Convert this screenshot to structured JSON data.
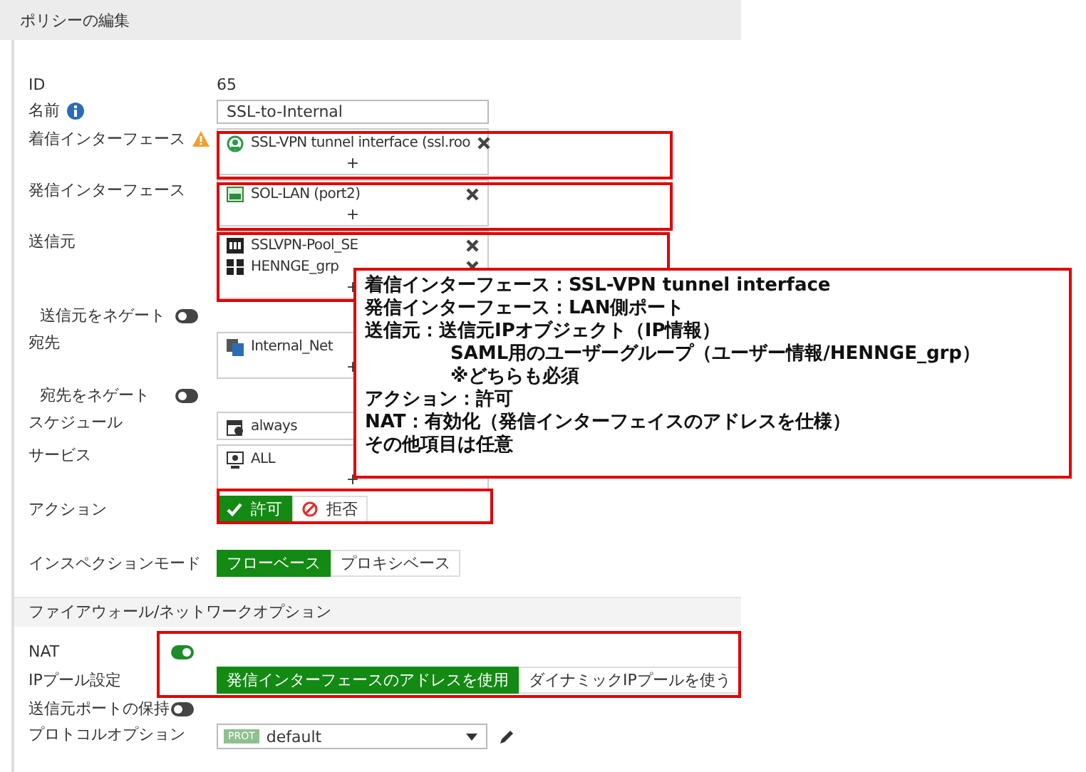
{
  "window": {
    "title": "ポリシーの編集"
  },
  "sections": [
    {
      "rows": [
        {
          "kind": "text",
          "label": "ID",
          "value": "65"
        },
        {
          "kind": "input",
          "label": "名前",
          "label_icon": {
            "kind": "info"
          },
          "value": "SSL-to-Internal"
        },
        {
          "kind": "multi",
          "label": "着信インターフェース",
          "label_icon": {
            "kind": "warning"
          },
          "entries": [
            {
              "kind": "tunnel",
              "text": "SSL-VPN tunnel interface (ssl.roo",
              "removable": true
            }
          ],
          "add": "+"
        },
        {
          "kind": "multi",
          "label": "発信インターフェース",
          "entries": [
            {
              "kind": "port",
              "text": "SOL-LAN (port2)",
              "removable": true
            }
          ],
          "add": "+"
        },
        {
          "kind": "multi",
          "label": "送信元",
          "entries": [
            {
              "kind": "range",
              "text": "SSLVPN-Pool_SE",
              "removable": true
            },
            {
              "kind": "group",
              "text": "HENNGE_grp",
              "removable": true
            }
          ],
          "add": "+",
          "negate": {
            "label": "送信元をネゲート",
            "on": false
          }
        },
        {
          "kind": "multi",
          "label": "宛先",
          "entries": [
            {
              "kind": "address",
              "text": "Internal_Net",
              "removable": false
            }
          ],
          "add": "+",
          "negate": {
            "label": "宛先をネゲート",
            "on": false
          }
        },
        {
          "kind": "single",
          "label": "スケジュール",
          "entries": [
            {
              "kind": "schedule",
              "text": "always"
            }
          ]
        },
        {
          "kind": "multi",
          "label": "サービス",
          "entries": [
            {
              "kind": "service",
              "text": "ALL",
              "removable": false
            }
          ],
          "add": "+"
        },
        {
          "kind": "segmented",
          "label": "アクション",
          "options": [
            {
              "kind": "check",
              "text": "許可",
              "selected": true
            },
            {
              "kind": "deny",
              "text": "拒否",
              "selected": false
            }
          ]
        },
        {
          "kind": "segmented",
          "label": "インスペクションモード",
          "options": [
            {
              "text": "フローベース",
              "selected": true
            },
            {
              "text": "プロキシベース",
              "selected": false
            }
          ]
        }
      ]
    },
    {
      "title": "ファイアウォール/ネットワークオプション",
      "rows": [
        {
          "kind": "toggle",
          "label": "NAT",
          "on": true
        },
        {
          "kind": "segmented",
          "label": "IPプール設定",
          "options": [
            {
              "text": "発信インターフェースのアドレスを使用",
              "selected": true
            },
            {
              "text": "ダイナミックIPプールを使う",
              "selected": false
            }
          ]
        },
        {
          "kind": "toggle",
          "label": "送信元ポートの保持",
          "on": false
        },
        {
          "kind": "select",
          "label": "プロトコルオプション",
          "badge": "PROT",
          "value": "default"
        }
      ]
    }
  ],
  "annotation": {
    "lines": [
      {
        "text": "着信インターフェース：SSL-VPN tunnel interface"
      },
      {
        "text": "発信インターフェース：LAN側ポート"
      },
      {
        "text": "送信元：送信元IPオブジェクト（IP情報）",
        "children": [
          {
            "text": "SAML用のユーザーグループ（ユーザー情報/HENNGE_grp）"
          },
          {
            "text": "※どちらも必須"
          }
        ]
      },
      {
        "text": "アクション：許可"
      },
      {
        "text": "NAT：有効化（発信インターフェイスのアドレスを仕様）"
      },
      {
        "text": "その他項目は任意"
      }
    ]
  }
}
